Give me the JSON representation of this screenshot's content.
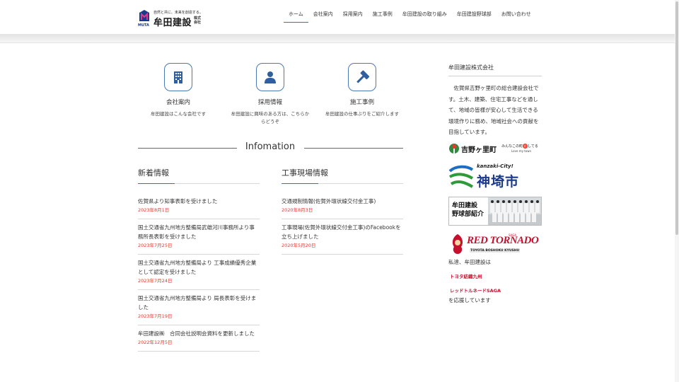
{
  "header": {
    "logo_tagline": "自然と共に、未来を創造する。",
    "logo_name": "牟田建設",
    "logo_suffix": "株式会社",
    "logo_mini": "MUTA",
    "nav": [
      "ホーム",
      "会社案内",
      "採用案内",
      "施工事例",
      "牟田建設の取り組み",
      "牟田建設野球部",
      "お問い合わせ"
    ],
    "active_index": 0
  },
  "features": [
    {
      "icon": "building-icon",
      "title": "会社案内",
      "desc": "牟田建設はこんな会社です"
    },
    {
      "icon": "person-icon",
      "title": "採用情報",
      "desc": "牟田建設に興味のある方は、こちらからどうぞ"
    },
    {
      "icon": "hammer-icon",
      "title": "施工事例",
      "desc": "牟田建設の仕事ぶりをご紹介します"
    }
  ],
  "info_heading": "Infomation",
  "news": {
    "title": "新着情報",
    "items": [
      {
        "title": "佐賀県より知事表彰を受けました",
        "date": "2023年8月1日"
      },
      {
        "title": "国土交通省九州地方整備局武雄河川事務所より事務所長表彰を受けました",
        "date": "2023年7月25日"
      },
      {
        "title": "国土交通省九州地方整備局より 工事成績優秀企業として認定を受けました",
        "date": "2023年7月24日"
      },
      {
        "title": "国土交通省九州地方整備局より 局長表彰を受けました",
        "date": "2023年7月19日"
      },
      {
        "title": "牟田建設㈱　合同会社説明会資料を更新しました",
        "date": "2022年12月5日"
      }
    ]
  },
  "sites": {
    "title": "工事現場情報",
    "items": [
      {
        "title": "交通規制情報(佐賀外環状線交付金工事)",
        "date": "2020年8月3日"
      },
      {
        "title": "工事現場(佐賀外環状線交付金工事)のFacebookを立ち上げました",
        "date": "2020年5月20日"
      }
    ]
  },
  "sidebar": {
    "title": "牟田建設株式会社",
    "text": "佐賀県吉野ヶ里町の総合建設会社です。土木、建築、住宅工事などを通して、地域の皆様が安心して生活できる環境作りに務め、地域社会への貢献を目指しています。",
    "yoshinogari": {
      "name": "吉野ヶ里町",
      "slogan": "みんなこの町",
      "slogan_mark": "好",
      "slogan_end": "してる",
      "slogan_en": "Love my town"
    },
    "kanzaki": {
      "roman": "kanzaki-City!",
      "name": "神埼市"
    },
    "baseball": {
      "line1": "牟田建設",
      "line2": "野球部紹介"
    },
    "tornado": {
      "name": "RED TORNADO",
      "sub": "TOYOTA BOSHOKU KYUSHU",
      "corner": "SAGA"
    },
    "support_intro": "私達、牟田建設は",
    "support_tags": [
      "トヨタ紡織九州",
      "レッドトルネードSAGA"
    ],
    "support_outro": "を応援しています"
  },
  "colors": {
    "accent": "#3a6fb0",
    "date": "#e0392b",
    "tag": "#c8102e"
  }
}
